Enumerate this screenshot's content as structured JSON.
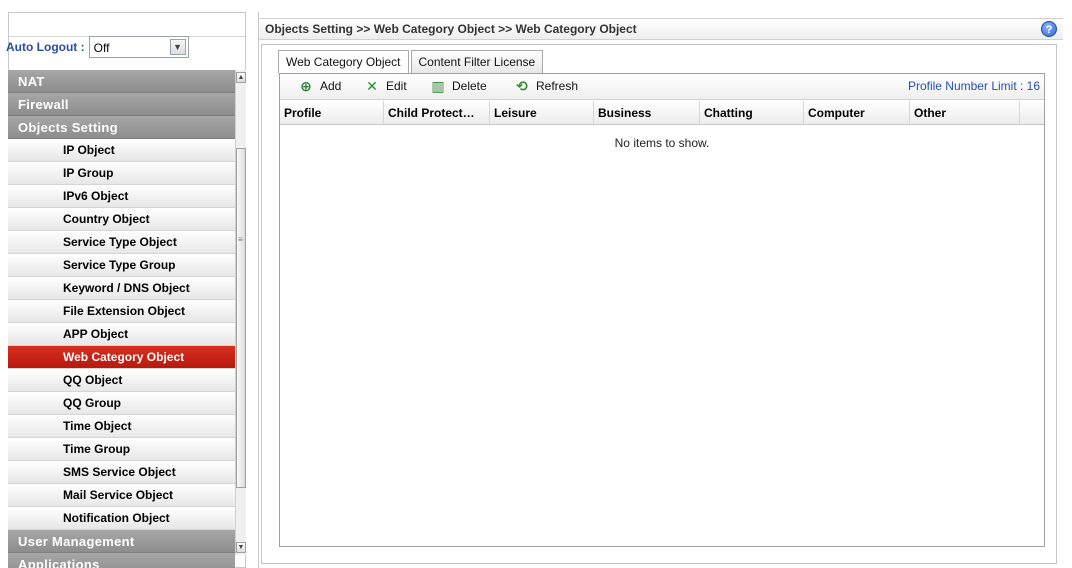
{
  "sidebar": {
    "auto_logout_label": "Auto Logout :",
    "auto_logout_value": "Off",
    "groups": {
      "nat": "NAT",
      "firewall": "Firewall",
      "objects_setting": "Objects Setting",
      "user_management": "User Management",
      "applications": "Applications"
    },
    "items": [
      "IP Object",
      "IP Group",
      "IPv6 Object",
      "Country Object",
      "Service Type Object",
      "Service Type Group",
      "Keyword / DNS Object",
      "File Extension Object",
      "APP Object",
      "Web Category Object",
      "QQ Object",
      "QQ Group",
      "Time Object",
      "Time Group",
      "SMS Service Object",
      "Mail Service Object",
      "Notification Object"
    ],
    "active_item": "Web Category Object"
  },
  "header": {
    "breadcrumb": "Objects Setting >> Web Category Object >> Web Category Object",
    "help_icon": "help-icon"
  },
  "tabs": [
    {
      "label": "Web Category Object",
      "active": true
    },
    {
      "label": "Content Filter License",
      "active": false
    }
  ],
  "toolbar": {
    "add_label": "Add",
    "edit_label": "Edit",
    "delete_label": "Delete",
    "refresh_label": "Refresh",
    "profile_limit": "Profile Number Limit : 16"
  },
  "table": {
    "columns": [
      "Profile",
      "Child Protect…",
      "Leisure",
      "Business",
      "Chatting",
      "Computer",
      "Other"
    ],
    "empty_text": "No items to show."
  },
  "colors": {
    "active_menu": "#c8231a",
    "group_header": "#9a9a9a",
    "link_blue": "#2452a8"
  }
}
